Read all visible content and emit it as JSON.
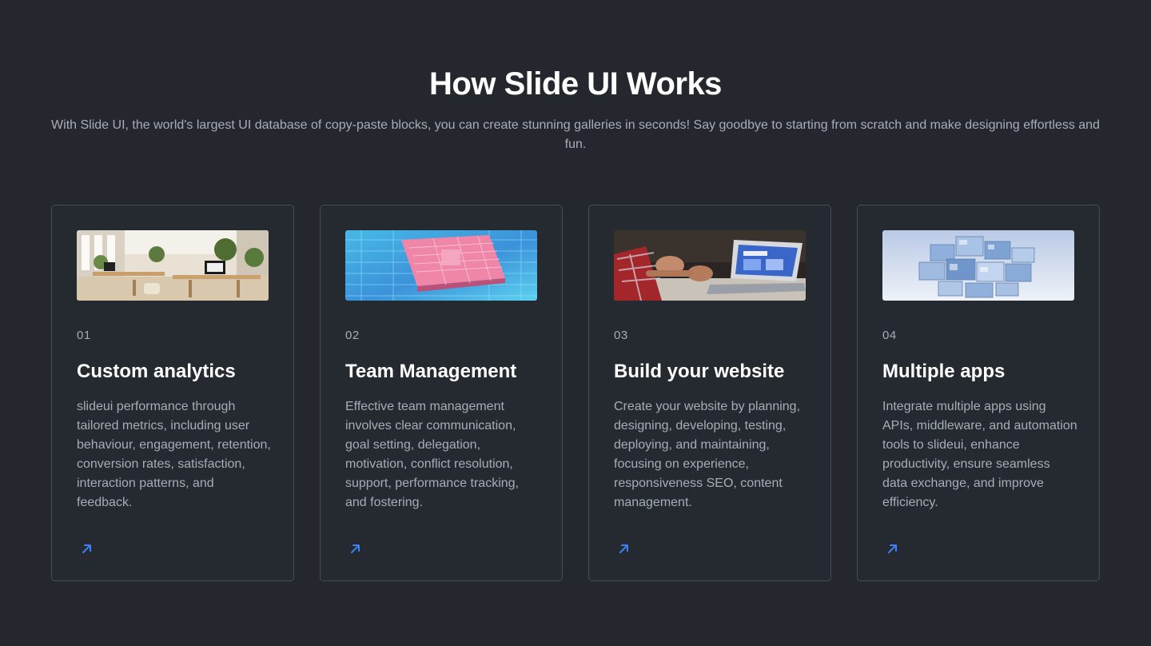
{
  "section": {
    "title": "How Slide UI Works",
    "subtitle": "With Slide UI, the world's largest UI database of copy-paste blocks, you can create stunning galleries in seconds! Say goodbye to starting from scratch and make designing effortless and fun."
  },
  "cards": [
    {
      "number": "01",
      "title": "Custom analytics",
      "description": "slideui performance through tailored metrics, including user behaviour, engagement, retention, conversion rates, satisfaction, interaction patterns, and feedback.",
      "image": "office-photo"
    },
    {
      "number": "02",
      "title": "Team Management",
      "description": "Effective team management involves clear communication, goal setting, delegation, motivation, conflict resolution, support, performance tracking, and fostering.",
      "image": "circuit-chip-photo"
    },
    {
      "number": "03",
      "title": "Build your website",
      "description": "Create your website by planning, designing, developing, testing, deploying, and maintaining, focusing on experience, responsiveness SEO, content management.",
      "image": "laptop-hands-photo"
    },
    {
      "number": "04",
      "title": "Multiple apps",
      "description": "Integrate multiple apps using APIs, middleware, and automation tools to slideui, enhance productivity, ensure seamless data exchange, and improve efficiency.",
      "image": "stacked-cubes-photo"
    }
  ],
  "colors": {
    "background": "#24282e",
    "card_border": "#474c55",
    "text_muted": "#a6adb7",
    "accent": "#3b82f6"
  },
  "icons": {
    "card_link": "arrow-up-right-icon"
  }
}
